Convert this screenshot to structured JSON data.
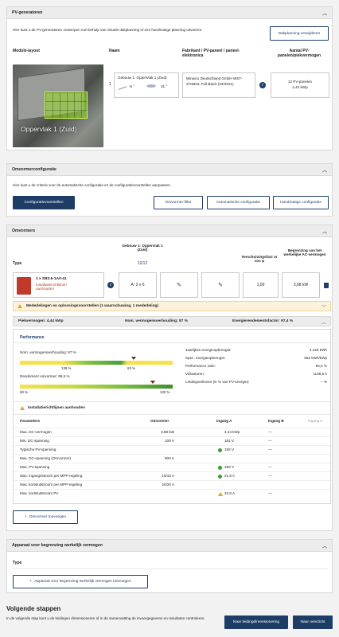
{
  "pv": {
    "title": "PV-generatoren",
    "intro": "Hier kunt u de PV-generatoren ontwerpen met behulp van visuele dakplanning of een handmatige planning uitvoeren.",
    "btn_remove": "Dakplanning verwijderen",
    "col_layout": "Module-layout",
    "col_name": "Naam",
    "col_mfr": "Fabrikant / PV-paneel / paneel-elektronica",
    "col_count": "Aantal PV-panelen/piekvermogen",
    "image_label": "Oppervlak 1 (Zuid)",
    "row_num": "1",
    "row_name": "Gebouw 1: Oppervlak 1 (Zuid)",
    "tilt": "-5 °",
    "azimuth": "31 °",
    "mfr": "Winaico Deutschland GmbH WST-370MGL Full Black (04/2021)",
    "count": "12 PV-panelen",
    "kwp": "4,44 kWp"
  },
  "inv_cfg": {
    "title": "Omvormerconfiguratie",
    "intro": "Hier kunt u de criteria voor de automatische configuratie en de configuratievoorstellen aanpassen.",
    "btn_proposals": "Configuratievoorstellen",
    "btn_filter": "Omvormer-filter",
    "btn_auto": "Automatische configuratie",
    "btn_manual": "Handmatige configuratie"
  },
  "inv": {
    "title": "Omvormers",
    "col_type": "Type",
    "col_building": "Gebouw 1: Oppervlak 1 (Zuid)",
    "col_building_count": "12/12",
    "col_shift": "Verschuivingsfact or cos φ",
    "col_limit": "Begrenzing van het werkelijke AC-vermogen",
    "model": "1 x SB3.6-1AV-41",
    "model_note": "Installatierichtlijnen aanhouden",
    "input_a": "A: 2 x 6",
    "cos_phi": "1,00",
    "limit": "3,68 kW",
    "messages": "Mededelingen en oplossingsvoorstellen (1 waarschuwing, 1 mededeling)",
    "peak": "Piekvermogen: 4,44 kWp",
    "ratio": "Nom. vermogensverhouding: 87 %",
    "energy_factor": "Energierendementsfactor: 97,4 %",
    "perf_title": "Performance",
    "bar1_label": "Nom. vermogensverhouding: 87 %",
    "bar1_value": 0.87,
    "bar1_min": "135 %",
    "bar1_mark": "83 %",
    "bar2_label": "Rendement omvormer: 95,5 %",
    "bar2_value": 0.955,
    "bar2_min": "90 %",
    "bar2_max": "100 %",
    "stats": [
      {
        "label": "Jaarlijkse energieopbrengst:",
        "value": "4.226 kWh"
      },
      {
        "label": "Spec. energieopbrengst:",
        "value": "952 kWh/kWp"
      },
      {
        "label": "Performance ratio:",
        "value": "84,5 %"
      },
      {
        "label": "Vollasturen:",
        "value": "1148,5 h"
      },
      {
        "label": "Leidingverliezen (in % van PV-energie):",
        "value": "-- %"
      }
    ],
    "warn": "Installatierichtlijnen aanhouden",
    "table_headers": [
      "Parameters",
      "Omvormer",
      "Ingang A",
      "Ingang B",
      "Ingang C"
    ],
    "table_rows": [
      [
        "Max. DC-vermogen",
        "3,88 kW",
        "4,44 kWp",
        "—"
      ],
      [
        "Min. DC-spanning",
        "100 V",
        "181 V",
        "—"
      ],
      [
        "Typische PV-spanning",
        "",
        "193 V",
        "—"
      ],
      [
        "Max. DC-spanning (Omvormer)",
        "600 V",
        "",
        ""
      ],
      [
        "Max. PV-spanning",
        "",
        "269 V",
        "—"
      ],
      [
        "Max. ingangsstroom per MPP-regeling",
        "15/15 A",
        "21,8 A",
        "—"
      ],
      [
        "Max. kortsluitstroom per MPP-regeling",
        "20/20 A",
        "",
        ""
      ],
      [
        "Max. kortsluitstroom PV",
        "",
        "22,8 A",
        "—"
      ]
    ],
    "btn_add": "Omvormer toevoegen"
  },
  "limit_dev": {
    "title": "Apparaat voor begrenzing werkelijk vermogen",
    "col_type": "Type",
    "btn_add": "Apparaat voor begrenzing werkelijk vermogen toevoegen"
  },
  "next": {
    "title": "Volgende stappen",
    "text": "In de volgende stap kunt u de leidingen dimensioneren of in de samenvatting de invoergegevens en resultaten controleren.",
    "btn_lines": "Naar leidingdimensionering",
    "btn_overview": "Naar overzicht"
  }
}
